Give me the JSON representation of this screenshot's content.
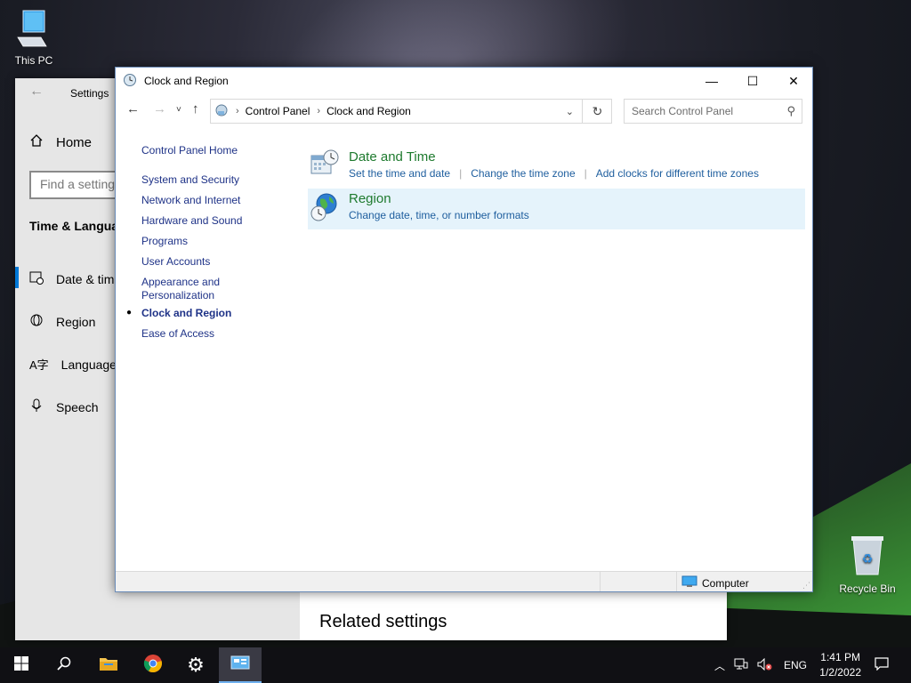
{
  "desktop": {
    "icons": [
      {
        "label": "This PC"
      },
      {
        "label": "Recycle Bin"
      }
    ]
  },
  "settings": {
    "title": "Settings",
    "home": "Home",
    "search_placeholder": "Find a setting",
    "section": "Time & Language",
    "items": [
      {
        "label": "Date & time",
        "icon": "calendar-clock-icon"
      },
      {
        "label": "Region",
        "icon": "globe-icon"
      },
      {
        "label": "Language",
        "icon": "language-icon"
      },
      {
        "label": "Speech",
        "icon": "microphone-icon"
      }
    ],
    "related_settings": "Related settings"
  },
  "control_panel": {
    "title": "Clock and Region",
    "breadcrumb": [
      "Control Panel",
      "Clock and Region"
    ],
    "search_placeholder": "Search Control Panel",
    "left_nav": {
      "home": "Control Panel Home",
      "items": [
        "System and Security",
        "Network and Internet",
        "Hardware and Sound",
        "Programs",
        "User Accounts",
        "Appearance and",
        "Personalization",
        "Clock and Region",
        "Ease of Access"
      ]
    },
    "categories": [
      {
        "title": "Date and Time",
        "links": [
          "Set the time and date",
          "Change the time zone",
          "Add clocks for different time zones"
        ]
      },
      {
        "title": "Region",
        "links": [
          "Change date, time, or number formats"
        ]
      }
    ],
    "status": "Computer"
  },
  "taskbar": {
    "language": "ENG",
    "time": "1:41 PM",
    "date": "1/2/2022"
  },
  "colors": {
    "accent": "#0078d7",
    "link": "#1e5e9e",
    "category_heading": "#1e7a2e",
    "highlight": "#e5f3fb"
  }
}
